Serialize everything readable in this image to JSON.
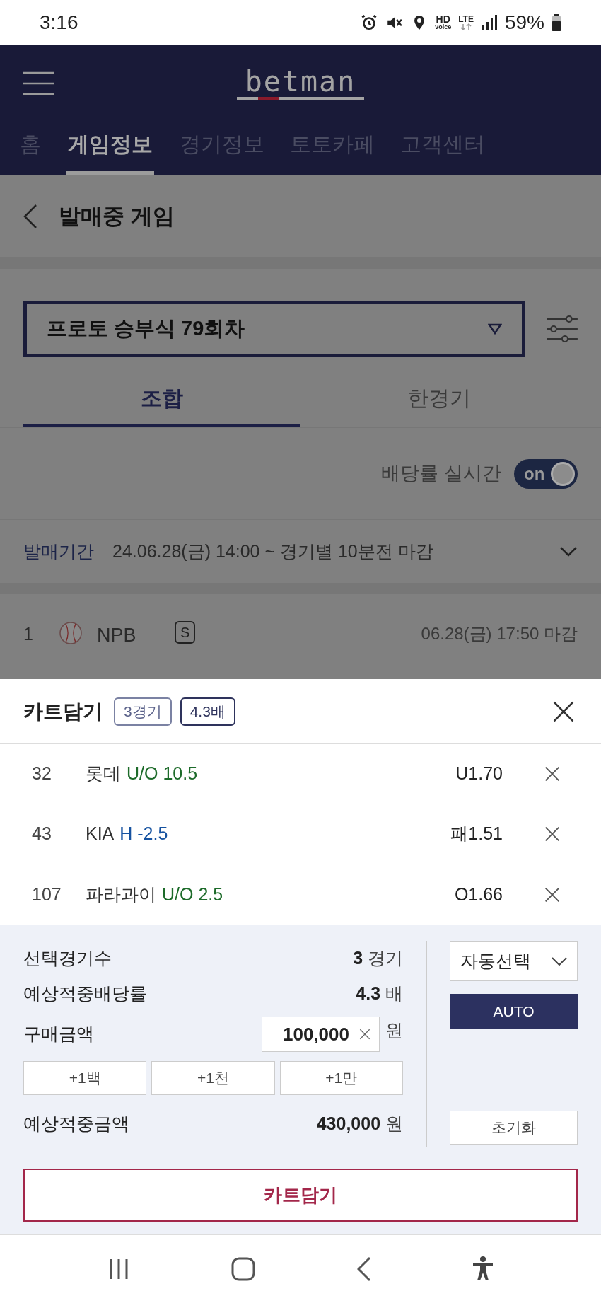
{
  "status_bar": {
    "time": "3:16",
    "hd": "HD",
    "voice": "voice",
    "lte": "LTE",
    "battery": "59%"
  },
  "header": {
    "logo": "betman",
    "nav_tabs": [
      {
        "label": "홈",
        "selected": false
      },
      {
        "label": "게임정보",
        "selected": true
      },
      {
        "label": "경기정보",
        "selected": false
      },
      {
        "label": "토토카페",
        "selected": false
      },
      {
        "label": "고객센터",
        "selected": false
      }
    ]
  },
  "page": {
    "title": "발매중 게임",
    "round_select": "프로토 승부식 79회차",
    "mode_tabs": [
      {
        "label": "조합",
        "selected": true
      },
      {
        "label": "한경기",
        "selected": false
      }
    ],
    "odds_live": {
      "label": "배당률 실시간",
      "on": true,
      "on_label": "on"
    },
    "sale_period": {
      "label": "발매기간",
      "value": "24.06.28(금) 14:00 ~ 경기별 10분전 마감"
    },
    "game": {
      "number": "1",
      "league": "NPB",
      "badge": "S",
      "deadline": "06.28(금) 17:50 마감"
    }
  },
  "cart": {
    "title": "카트담기",
    "badges": [
      "3경기",
      "4.3배"
    ],
    "picks": [
      {
        "number": "32",
        "team": "롯데",
        "market": "U/O 10.5",
        "kind": "over_under",
        "odds": "U1.70"
      },
      {
        "number": "43",
        "team": "KIA",
        "market": "H -2.5",
        "kind": "handicap",
        "odds": "패1.51"
      },
      {
        "number": "107",
        "team": "파라과이",
        "market": "U/O 2.5",
        "kind": "over_under",
        "odds": "O1.66"
      }
    ],
    "summary": {
      "selected_games": {
        "label": "선택경기수",
        "value": "3",
        "unit": "경기"
      },
      "expected_odds": {
        "label": "예상적중배당률",
        "value": "4.3",
        "unit": "배"
      },
      "amount": {
        "label": "구매금액",
        "value": "100,000",
        "unit": "원"
      },
      "quick_add": [
        "+1백",
        "+1천",
        "+1만"
      ],
      "expected_win": {
        "label": "예상적중금액",
        "value": "430,000",
        "unit": "원"
      },
      "select_mode": "자동선택",
      "auto_button": "AUTO",
      "reset_button": "초기화"
    },
    "submit_button": "카트담기"
  }
}
